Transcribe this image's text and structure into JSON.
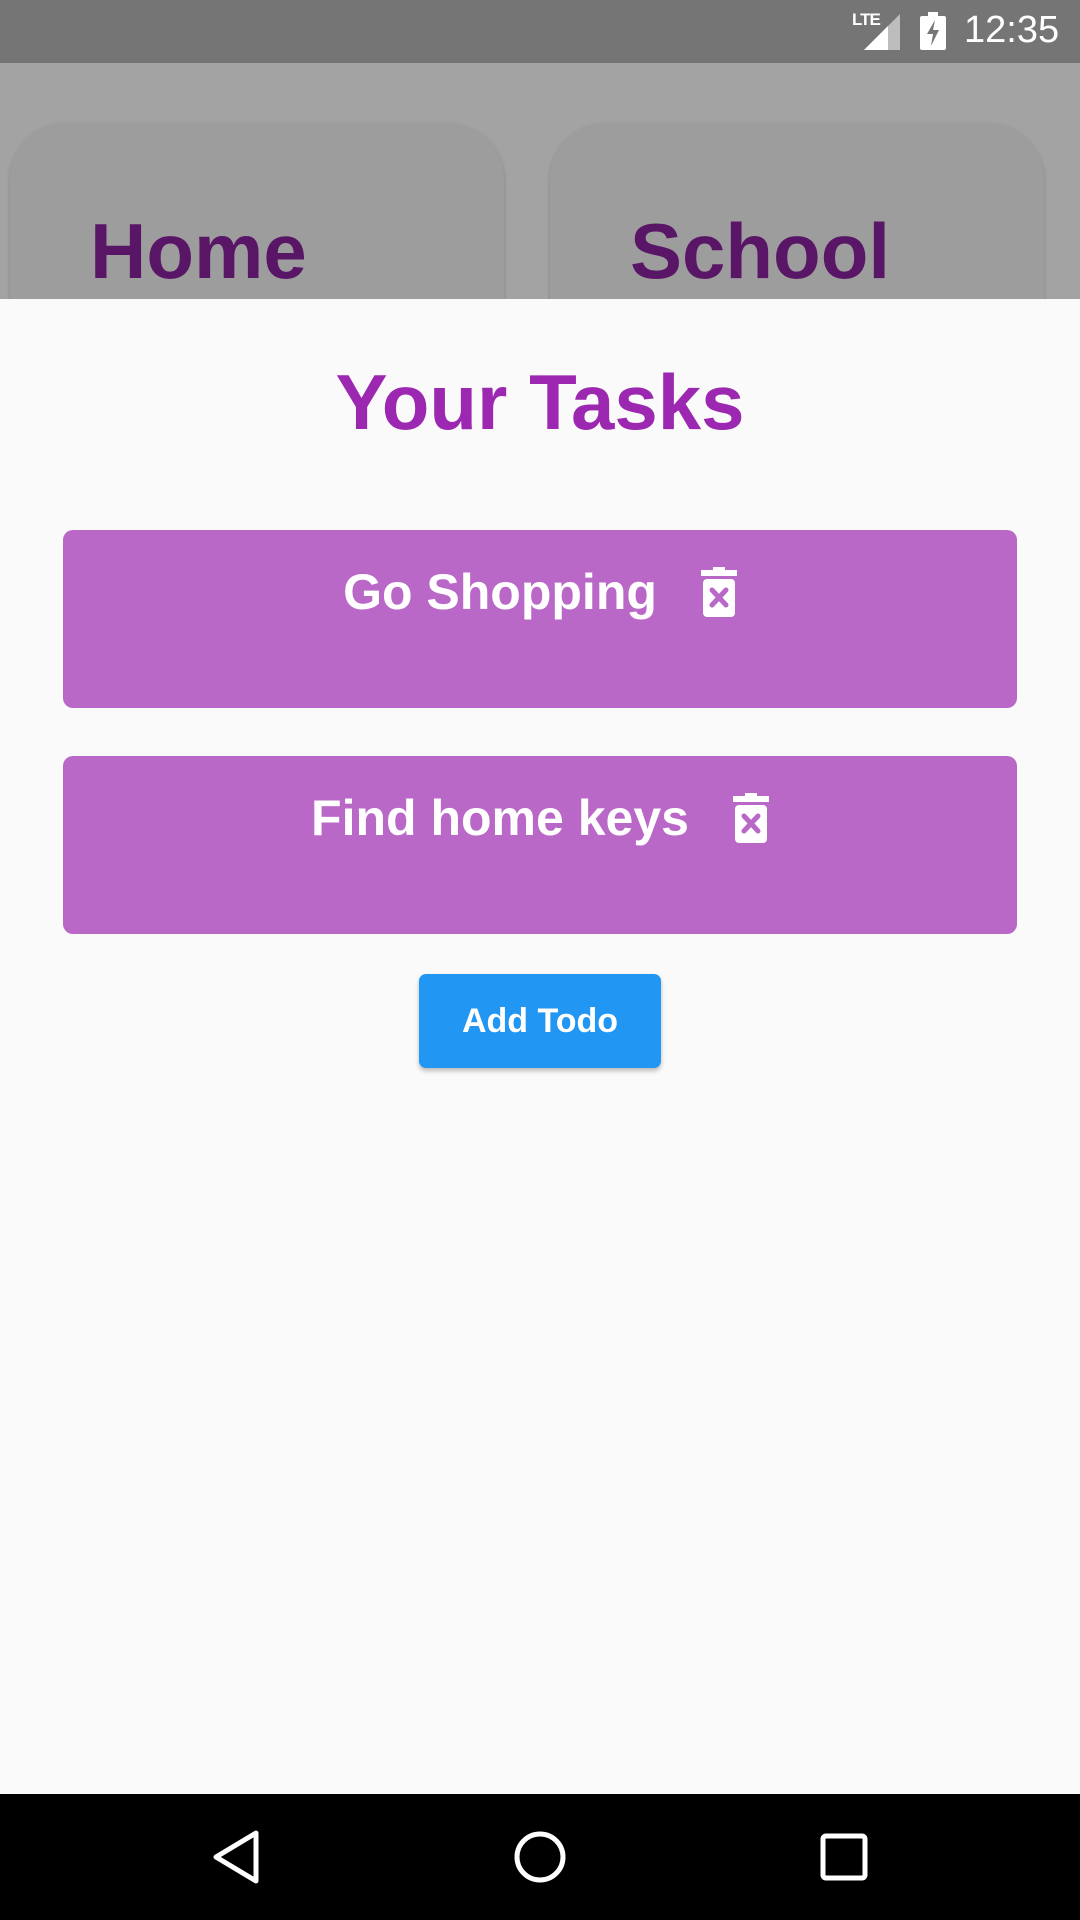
{
  "status_bar": {
    "network": "LTE",
    "time": "12:35",
    "icons": [
      "lte-signal-icon",
      "battery-charging-icon"
    ]
  },
  "background": {
    "categories": [
      {
        "label": "Home"
      },
      {
        "label": "School"
      }
    ]
  },
  "sheet": {
    "title": "Your Tasks",
    "tasks": [
      {
        "label": "Go Shopping",
        "icon": "trash-icon"
      },
      {
        "label": "Find home keys",
        "icon": "trash-icon"
      }
    ],
    "add_button_label": "Add Todo"
  },
  "nav_bar": {
    "icons": [
      "back-icon",
      "home-circle-icon",
      "recents-square-icon"
    ]
  },
  "colors": {
    "title": "#9c27b0",
    "task_card": "#ba68c8",
    "add_button": "#2196f3",
    "category_label": "#5a1666"
  }
}
